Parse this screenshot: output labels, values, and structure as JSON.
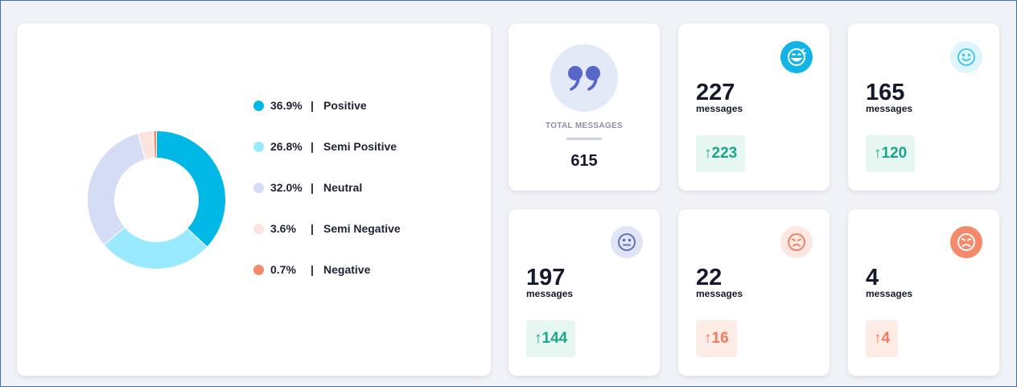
{
  "sentiment_chart": {
    "legend": [
      {
        "pct": "36.9%",
        "sep": "|",
        "label": "Positive",
        "color": "#00b8e6"
      },
      {
        "pct": "26.8%",
        "sep": "|",
        "label": "Semi Positive",
        "color": "#9aeaff"
      },
      {
        "pct": "32.0%",
        "sep": "|",
        "label": "Neutral",
        "color": "#d5dcf5"
      },
      {
        "pct": "3.6%",
        "sep": "|",
        "label": "Semi Negative",
        "color": "#fde3dd"
      },
      {
        "pct": "0.7%",
        "sep": "|",
        "label": "Negative",
        "color": "#f58a6b"
      }
    ]
  },
  "chart_data": {
    "type": "pie",
    "donut": true,
    "slices": [
      {
        "label": "Positive",
        "value": 36.9,
        "color": "#00b8e6"
      },
      {
        "label": "Semi Positive",
        "value": 26.8,
        "color": "#9aeaff"
      },
      {
        "label": "Neutral",
        "value": 32.0,
        "color": "#d5dcf5"
      },
      {
        "label": "Semi Negative",
        "value": 3.6,
        "color": "#fde3dd"
      },
      {
        "label": "Negative",
        "value": 0.7,
        "color": "#f58a6b"
      }
    ]
  },
  "total": {
    "icon": "quote-icon",
    "label": "TOTAL MESSAGES",
    "value": "615"
  },
  "cards": [
    {
      "id": "positive",
      "count": "227",
      "unit": "messages",
      "change": "↑223",
      "trend": "green",
      "icon": "laughing-face-icon",
      "icon_bg": "#11b4e4",
      "icon_fg": "#ffffff"
    },
    {
      "id": "semi-positive",
      "count": "165",
      "unit": "messages",
      "change": "↑120",
      "trend": "green",
      "icon": "smile-face-icon",
      "icon_bg": "#dff5fd",
      "icon_fg": "#3cc4ee"
    },
    {
      "id": "neutral",
      "count": "197",
      "unit": "messages",
      "change": "↑144",
      "trend": "green",
      "icon": "neutral-face-icon",
      "icon_bg": "#dfe4f7",
      "icon_fg": "#5869b0"
    },
    {
      "id": "semi-negative",
      "count": "22",
      "unit": "messages",
      "change": "↑16",
      "trend": "red",
      "icon": "annoyed-face-icon",
      "icon_bg": "#fde7e1",
      "icon_fg": "#f07a5c"
    },
    {
      "id": "negative",
      "count": "4",
      "unit": "messages",
      "change": "↑4",
      "trend": "red",
      "icon": "angry-face-icon",
      "icon_bg": "#f58a6b",
      "icon_fg": "#ffffff"
    }
  ]
}
